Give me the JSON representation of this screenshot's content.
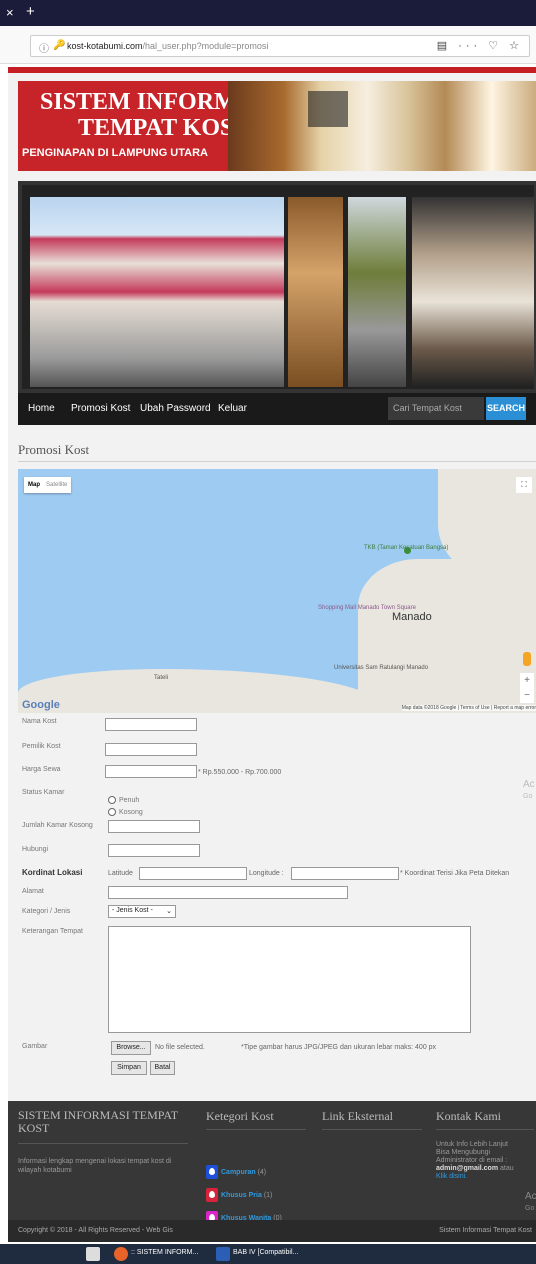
{
  "browser": {
    "url_domain": "kost-kotabumi.com",
    "url_path": "/hal_user.php?module=promosi",
    "tab_close": "×",
    "tab_new": "+"
  },
  "banner": {
    "line1": "SISTEM INFORMASI",
    "line2": "TEMPAT KOST",
    "line3": "PENGINAPAN DI LAMPUNG UTARA"
  },
  "nav": {
    "items": [
      "Home",
      "Promosi Kost",
      "Ubah Password",
      "Keluar"
    ],
    "search_placeholder": "Cari Tempat Kost",
    "search_button": "SEARCH"
  },
  "section_title": "Promosi Kost",
  "map": {
    "type_map": "Map",
    "type_satellite": "Satellite",
    "city": "Manado",
    "place1": "TKB (Taman Kesatuan Bangsa)",
    "place2": "Shopping Mall Manado Town Square",
    "place3": "Universitas Sam Ratulangi Manado",
    "place4": "Tateli",
    "logo": "Google",
    "attribution": "Map data ©2018 Google | Terms of Use | Report a map error"
  },
  "form": {
    "nama_kost": "Nama Kost",
    "pemilik_kost": "Pemilik Kost",
    "harga_sewa": "Harga Sewa",
    "harga_hint": "* Rp.550.000 - Rp.700.000",
    "status_kamar": "Status Kamar",
    "status_penuh": "Penuh",
    "status_kosong": "Kosong",
    "jumlah_kamar": "Jumlah Kamar Kosong",
    "hubungi": "Hubungi",
    "kordinat": "Kordinat Lokasi",
    "latitude": "Latitude",
    "longitude": "Longitude :",
    "kordinat_hint": "* Koordinat Terisi Jika Peta Ditekan",
    "alamat": "Alamat",
    "kategori": "Kategori / Jenis",
    "kategori_value": "- Jenis Kost -",
    "keterangan": "Keterangan Tempat",
    "gambar": "Gambar",
    "browse": "Browse...",
    "no_file": "No file selected.",
    "gambar_hint": "*Tipe gambar harus JPG/JPEG dan ukuran lebar maks: 400 px",
    "simpan": "Simpan",
    "batal": "Batal"
  },
  "side_ad": {
    "a": "Ac",
    "b": "Go",
    "c": "Ac",
    "d": "Go"
  },
  "footer": {
    "col1_title": "SISTEM INFORMASI TEMPAT KOST",
    "col1_text": "Informasi lengkap mengenai lokasi tempat kost di wilayah kotabumi",
    "col2_title": "Ketegori Kost",
    "cats": [
      {
        "name": "Campuran",
        "count": "(4)",
        "color": "#1e4fd8"
      },
      {
        "name": "Khusus Pria",
        "count": "(1)",
        "color": "#d8243a"
      },
      {
        "name": "Khusus Wanita",
        "count": "(0)",
        "color": "#d826c8"
      }
    ],
    "col3_title": "Link Eksternal",
    "col4_title": "Kontak Kami",
    "contact_line1": "Untuk Info Lebih Lanjut",
    "contact_line2": "Bisa Mengubungi",
    "contact_line3": "Administrator di email :",
    "contact_email": "admin@gmail.com",
    "contact_or": "atau",
    "contact_link": "Klik disini."
  },
  "copyright": {
    "left": "Copyright © 2018 - All Rights Reserved - Web Gis",
    "right": "Sistem Informasi Tempat Kost"
  },
  "taskbar": {
    "item1": ":: SISTEM INFORM...",
    "item2": "BAB IV [Compatibil..."
  }
}
